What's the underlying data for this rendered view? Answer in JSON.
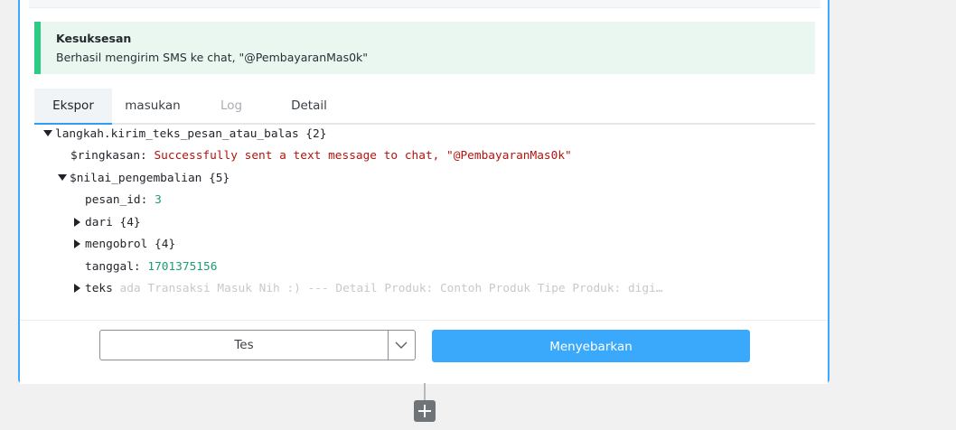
{
  "banner": {
    "title": "Kesuksesan",
    "message": "Berhasil mengirim SMS ke chat, \"@PembayaranMas0k\"",
    "accent_color": "#2dcc85"
  },
  "tabs": [
    {
      "label": "Ekspor",
      "state": "active"
    },
    {
      "label": "masukan",
      "state": "normal"
    },
    {
      "label": "Log",
      "state": "disabled"
    },
    {
      "label": "Detail",
      "state": "normal"
    }
  ],
  "tree": {
    "root_label": "langkah.kirim_teks_pesan_atau_balas {2}",
    "summary_key": "$ringkasan:",
    "summary_value": "Successfully sent a text message to chat, \"@PembayaranMas0k\"",
    "return_label": "$nilai_pengembalian {5}",
    "message_id_key": "pesan_id:",
    "message_id_value": "3",
    "from_label": "dari {4}",
    "chat_label": "mengobrol {4}",
    "date_key": "tanggal:",
    "date_value": "1701375156",
    "text_key": "teks",
    "text_preview": "ada Transaksi Masuk Nih :) --- Detail Produk: Contoh Produk Tipe Produk: digi…"
  },
  "footer": {
    "test_select_value": "Tes",
    "publish_label": "Menyebarkan"
  },
  "add_step_icon": "plus-icon",
  "colors": {
    "primary": "#3aa8fb",
    "string": "#b3140e",
    "number": "#1a9e73"
  }
}
